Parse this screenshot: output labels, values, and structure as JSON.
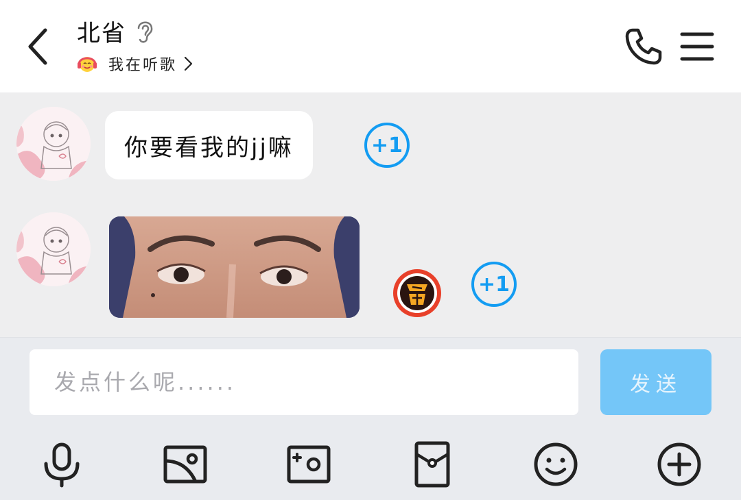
{
  "header": {
    "title": "北省",
    "status_text": "我在听歌",
    "icons": {
      "back": "back-arrow-icon",
      "ear": "ear-icon",
      "status": "headphones-smile-emoji-icon",
      "chevron": "chevron-right-icon",
      "phone": "phone-icon",
      "menu": "hamburger-menu-icon"
    }
  },
  "messages": [
    {
      "type": "text",
      "text": "你要看我的jj嘛",
      "plus_one": "+1"
    },
    {
      "type": "image",
      "description_icon": "photo",
      "plus_one": "+1",
      "sticker_icon": "angry-sticker-icon"
    }
  ],
  "composer": {
    "placeholder": "发点什么呢......",
    "send_label": "发送"
  },
  "toolbar": {
    "items": [
      "microphone-icon",
      "image-icon",
      "camera-icon",
      "red-packet-icon",
      "emoji-icon",
      "add-icon"
    ]
  },
  "colors": {
    "accent": "#139cf2",
    "send_button": "#74c6f8",
    "chat_background": "#eeeeef",
    "input_area_background": "#e9ebef"
  }
}
